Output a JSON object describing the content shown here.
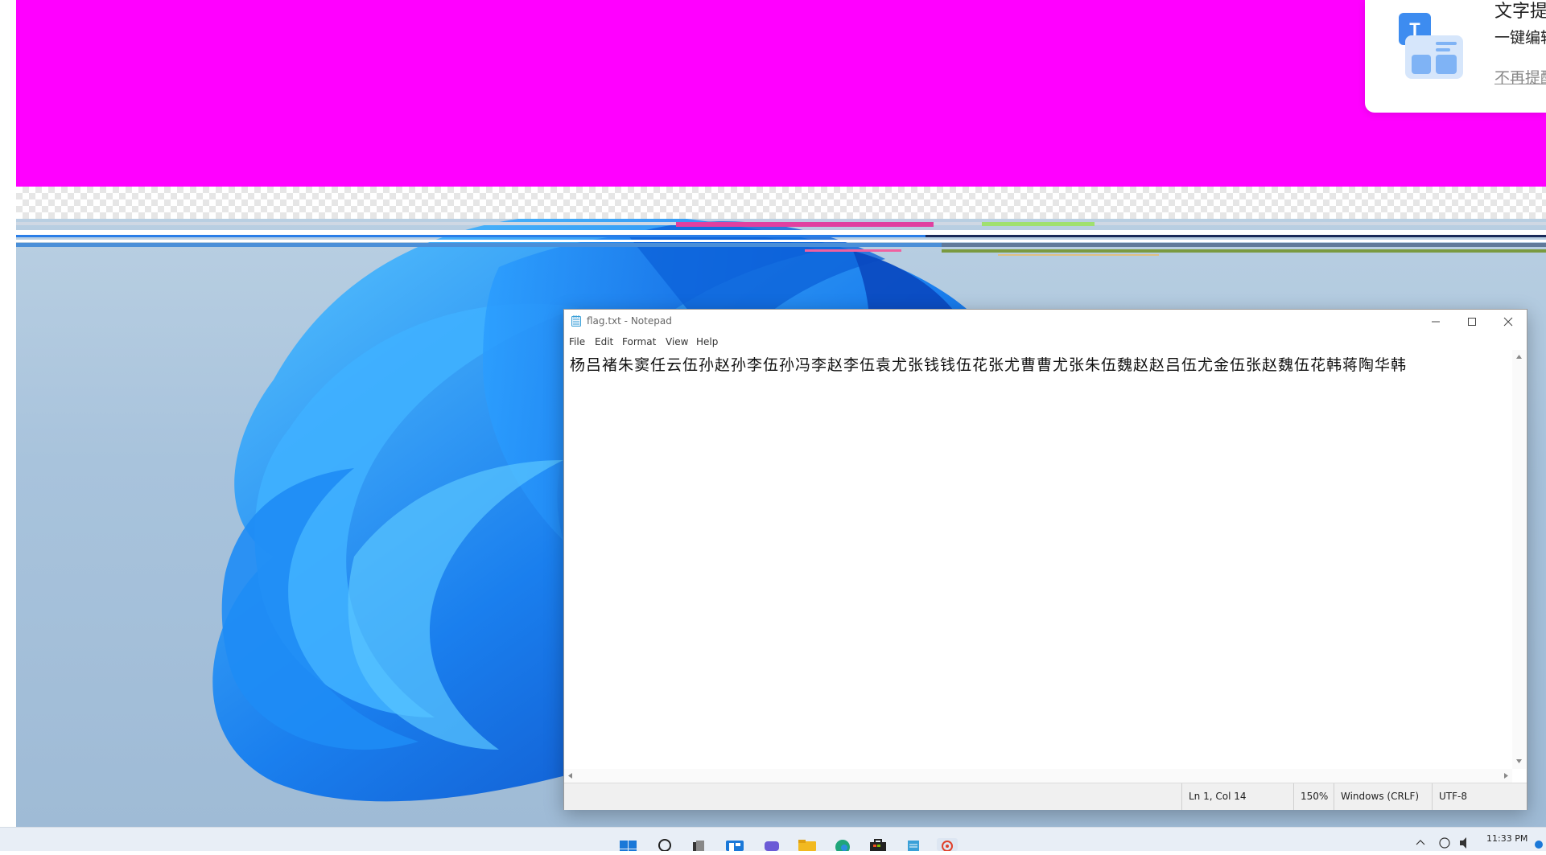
{
  "notification": {
    "title": "文字提",
    "subtitle": "一键编辑",
    "link": "不再提醒"
  },
  "notepad": {
    "title": "flag.txt - Notepad",
    "menu": [
      "File",
      "Edit",
      "Format",
      "View",
      "Help"
    ],
    "content": "杨吕褚朱窦任云伍孙赵孙李伍孙冯李赵李伍袁尤张钱钱伍花张尤曹曹尤张朱伍魏赵赵吕伍尤金伍张赵魏伍花韩蒋陶华韩",
    "status": {
      "position": "Ln 1, Col 14",
      "zoom": "150%",
      "line_ending": "Windows (CRLF)",
      "encoding": "UTF-8"
    }
  },
  "taskbar": {
    "icons": [
      "windows-start-icon",
      "search-icon",
      "task-view-icon",
      "widgets-icon",
      "teams-chat-icon",
      "file-explorer-icon",
      "edge-icon",
      "store-icon",
      "notepad-icon",
      "app-icon"
    ],
    "clock": "11:33 PM"
  },
  "colors": {
    "magenta": "#ff00ff",
    "accent": "#0a74d6"
  }
}
